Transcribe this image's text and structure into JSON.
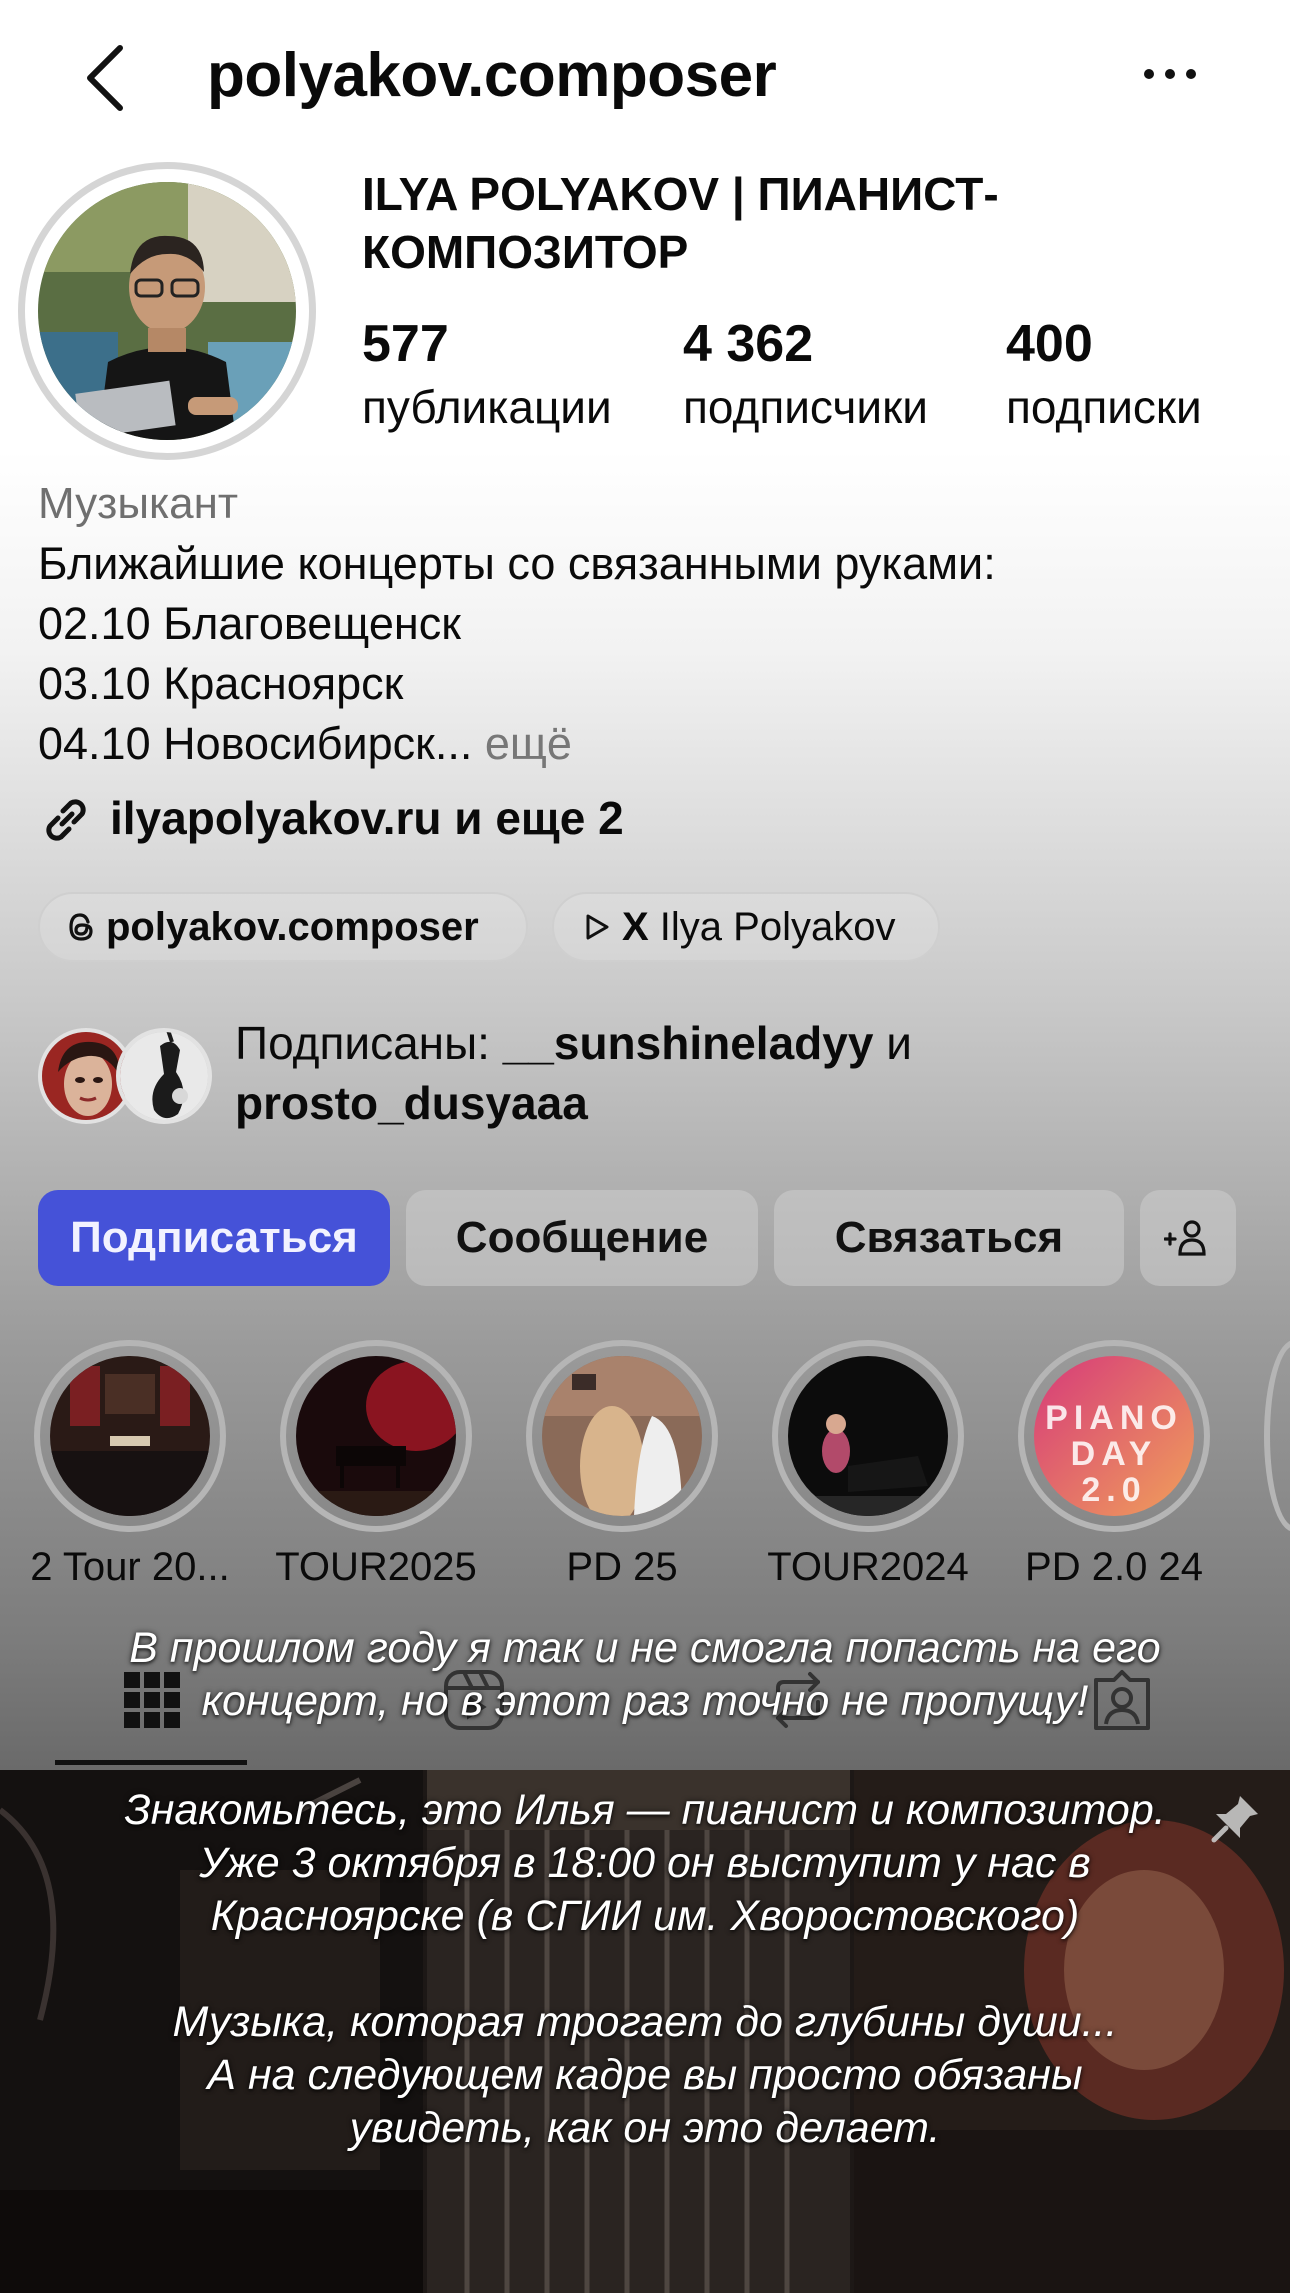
{
  "header": {
    "username": "polyakov.composer",
    "back_icon": "chevron-left-icon",
    "more_icon": "more-horizontal-icon"
  },
  "profile": {
    "display_name": "ILYA POLYAKOV | ПИАНИСТ-КОМПОЗИТОР",
    "stats": [
      {
        "value": "577",
        "label": "публикации"
      },
      {
        "value": "4 362",
        "label": "подписчики"
      },
      {
        "value": "400",
        "label": "подписки"
      }
    ]
  },
  "bio": {
    "category": "Музыкант",
    "lines": [
      "Ближайшие концерты со связанными руками:",
      "02.10 Благовещенск",
      "03.10 Красноярск",
      "04.10 Новосибирск..."
    ],
    "more": " ещё",
    "link": "ilyapolyakov.ru и еще 2"
  },
  "chips": [
    {
      "icon": "threads-icon",
      "label": "polyakov.composer"
    },
    {
      "icon": "play-icon",
      "label_bold": "X",
      "label": " Ilya Polyakov"
    }
  ],
  "followed_by": {
    "prefix": "Подписаны: ",
    "user1": "__sunshineladyy",
    "joiner": " и",
    "user2": "prosto_dusyaaa"
  },
  "actions": {
    "follow": "Подписаться",
    "message": "Сообщение",
    "contact": "Связаться",
    "add_person_icon": "add-person-icon"
  },
  "highlights": [
    {
      "label": "2 Tour 20..."
    },
    {
      "label": "TOUR2025"
    },
    {
      "label": "PD 25"
    },
    {
      "label": "TOUR2024"
    },
    {
      "label": "PD 2.0 24",
      "cover_text": "PIANO DAY 2.0"
    }
  ],
  "tabs": [
    "grid-icon",
    "reels-icon",
    "reposts-icon",
    "tagged-icon"
  ],
  "overlay": {
    "caption_top": [
      "В прошлом году я так и не смогла попасть на его",
      "концерт, но в этот раз точно не пропущу!"
    ],
    "caption_bottom": [
      "Знакомьтесь, это Илья — пианист и композитор.",
      "Уже 3 октября в 18:00 он выступит у нас в",
      "Красноярске (в СГИИ им. Хворостовского)",
      "",
      "Музыка, которая трогает до глубины души...",
      "А на следующем кадре вы просто обязаны",
      "увидеть, как он это делает."
    ]
  },
  "colors": {
    "follow_button": "#4552d8",
    "secondary_button": "#cdcdcd",
    "highlight_ring": "#b5b5b5"
  }
}
